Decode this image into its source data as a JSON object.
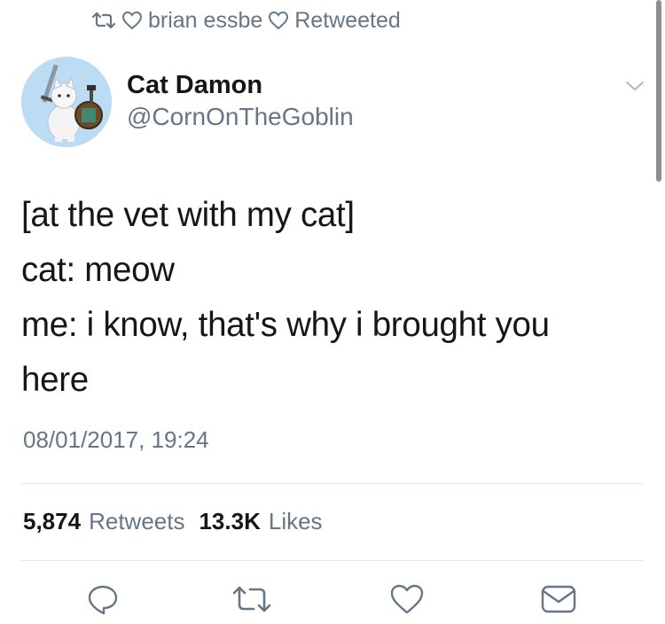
{
  "context": {
    "retweeter": "brian essbe",
    "label": "Retweeted"
  },
  "user": {
    "display_name": "Cat Damon",
    "handle": "@CornOnTheGoblin"
  },
  "tweet": {
    "lines": [
      "[at the vet with my cat]",
      "cat: meow",
      "me: i know, that's why i brought you",
      "here"
    ],
    "timestamp": "08/01/2017, 19:24"
  },
  "stats": {
    "retweet_count": "5,874",
    "retweet_label": "Retweets",
    "like_count": "13.3K",
    "like_label": "Likes"
  },
  "icons": {
    "context_retweet": "retweet-icon",
    "context_like": "heart-icon",
    "menu": "chevron-down-icon",
    "actions": [
      "reply-icon",
      "retweet-icon",
      "heart-icon",
      "mail-icon"
    ]
  },
  "colors": {
    "text": "#14171a",
    "secondary": "#657786",
    "divider": "#e1e8ed"
  }
}
